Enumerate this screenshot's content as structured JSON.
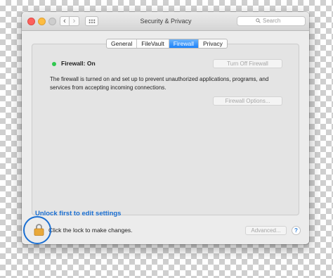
{
  "window": {
    "title": "Security & Privacy",
    "back_glyph": "‹",
    "forward_glyph": "›"
  },
  "search": {
    "placeholder": "Search",
    "icon": "magnifier-icon"
  },
  "tabs": [
    {
      "label": "General",
      "active": false
    },
    {
      "label": "FileVault",
      "active": false
    },
    {
      "label": "Firewall",
      "active": true
    },
    {
      "label": "Privacy",
      "active": false
    }
  ],
  "firewall": {
    "status": "Firewall: On",
    "status_color": "#2fc84f",
    "turn_off_label": "Turn Off Firewall",
    "description": "The firewall is turned on and set up to prevent unauthorized applications, programs, and services from accepting incoming connections.",
    "options_label": "Firewall Options..."
  },
  "footer": {
    "lock_icon": "padlock-icon",
    "lock_text": "Click the lock to make changes.",
    "advanced_label": "Advanced...",
    "help_label": "?"
  },
  "annotation": {
    "text": "Unlock first to edit settings",
    "color": "#1b6fd1"
  },
  "colors": {
    "accent": "#1a82fb",
    "close": "#fc605c",
    "minimize": "#fdbc40"
  }
}
